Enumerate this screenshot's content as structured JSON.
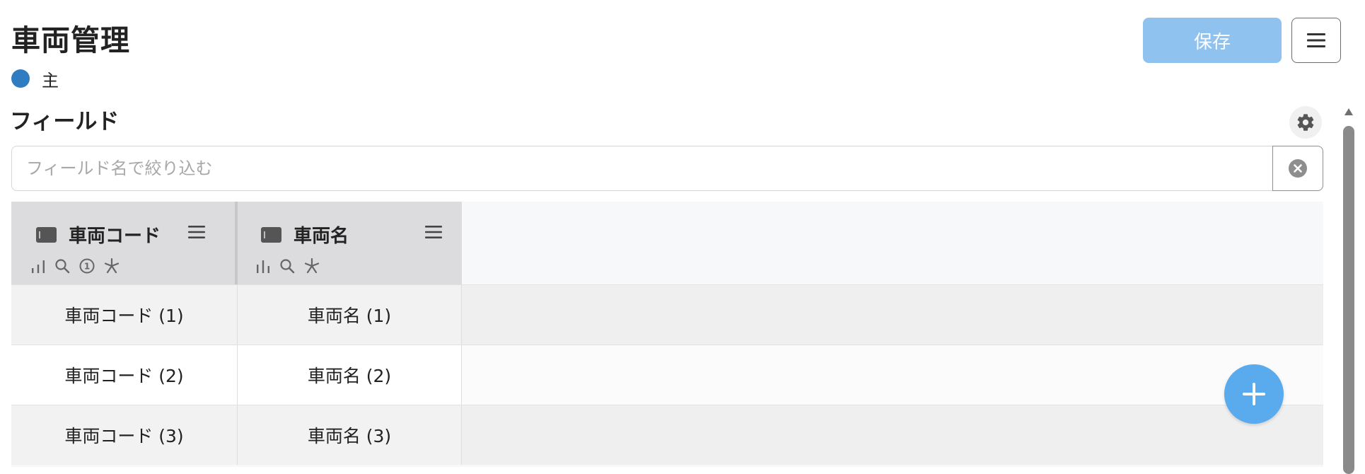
{
  "header": {
    "title": "車両管理",
    "status_label": "主",
    "status_color": "#2f7cc1",
    "save_label": "保存",
    "menu_icon": "hamburger-menu-icon"
  },
  "fields": {
    "section_label": "フィールド",
    "settings_icon": "gear-icon",
    "filter_placeholder": "フィールド名で絞り込む",
    "filter_value": "",
    "clear_icon": "clear-circle-icon"
  },
  "columns": [
    {
      "title": "車両コード",
      "type_icon": "text-field-icon",
      "feature_icons": [
        "bar-chart-icon",
        "search-icon",
        "unique-key-icon",
        "required-star-icon"
      ]
    },
    {
      "title": "車両名",
      "type_icon": "text-field-icon",
      "feature_icons": [
        "bar-chart-icon",
        "search-icon",
        "required-star-icon"
      ]
    }
  ],
  "rows": [
    [
      "車両コード (1)",
      "車両名 (1)"
    ],
    [
      "車両コード (2)",
      "車両名 (2)"
    ],
    [
      "車両コード (3)",
      "車両名 (3)"
    ]
  ],
  "fab_icon": "plus-icon",
  "colors": {
    "save_button": "#90c2f0",
    "fab": "#5aabed",
    "header_bg": "#dcdcde"
  }
}
